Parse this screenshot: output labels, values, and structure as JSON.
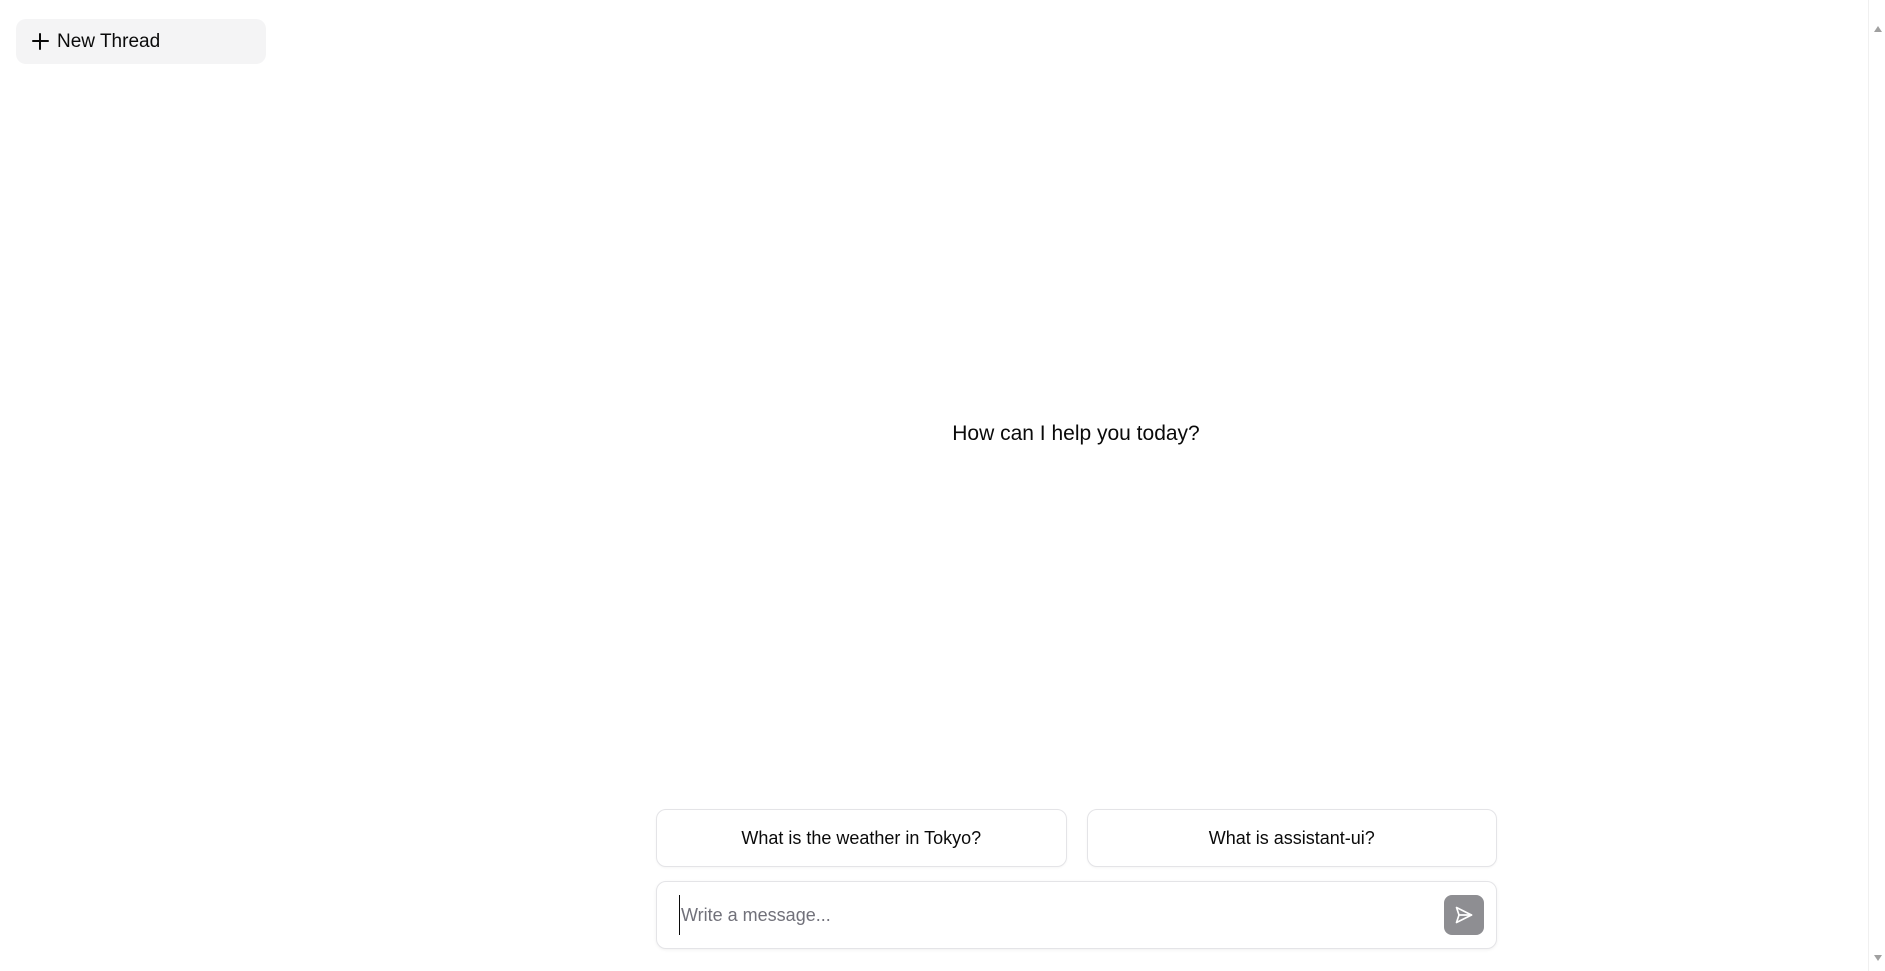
{
  "sidebar": {
    "new_thread_label": "New Thread",
    "new_thread_icon": "plus-icon"
  },
  "thread": {
    "welcome_message": "How can I help you today?"
  },
  "suggestions": [
    {
      "label": "What is the weather in Tokyo?"
    },
    {
      "label": "What is assistant-ui?"
    }
  ],
  "composer": {
    "placeholder": "Write a message...",
    "value": "",
    "send_icon": "send-icon",
    "send_button_color": "#8e8e92"
  },
  "colors": {
    "background": "#ffffff",
    "sidebar_button_bg": "#f4f4f5",
    "border": "#e4e4e7",
    "text": "#0a0a0a",
    "placeholder": "#71717a"
  }
}
